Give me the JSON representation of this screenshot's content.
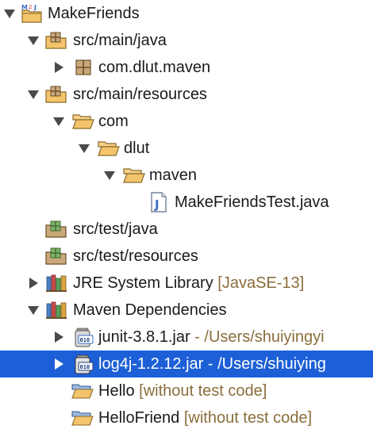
{
  "tree": {
    "project": {
      "label": "MakeFriends",
      "icon": "maven-project-icon",
      "expanded": true
    },
    "src_main_java": {
      "label": "src/main/java",
      "icon": "source-folder-icon",
      "expanded": true
    },
    "pkg_com_dlut_maven": {
      "label": "com.dlut.maven",
      "icon": "package-icon",
      "expanded": false
    },
    "src_main_resources": {
      "label": "src/main/resources",
      "icon": "source-folder-icon",
      "expanded": true
    },
    "folder_com": {
      "label": "com",
      "icon": "folder-icon",
      "expanded": true
    },
    "folder_dlut": {
      "label": "dlut",
      "icon": "folder-icon",
      "expanded": true
    },
    "folder_maven": {
      "label": "maven",
      "icon": "folder-icon",
      "expanded": true
    },
    "file_test_java": {
      "label": "MakeFriendsTest.java",
      "icon": "java-file-icon"
    },
    "src_test_java": {
      "label": "src/test/java",
      "icon": "source-folder-icon"
    },
    "src_test_resources": {
      "label": "src/test/resources",
      "icon": "source-folder-icon"
    },
    "jre_library": {
      "label": "JRE System Library",
      "decoration": "[JavaSE-13]",
      "icon": "library-icon",
      "expanded": false
    },
    "maven_deps": {
      "label": "Maven Dependencies",
      "icon": "library-icon",
      "expanded": true
    },
    "junit_jar": {
      "label": "junit-3.8.1.jar",
      "decoration": "- /Users/shuiyingyi",
      "icon": "jar-icon",
      "expanded": false
    },
    "log4j_jar": {
      "label": "log4j-1.2.12.jar",
      "decoration": "- /Users/shuiying",
      "icon": "jar-icon",
      "expanded": false,
      "selected": true
    },
    "hello_project": {
      "label": "Hello",
      "decoration": "[without test code]",
      "icon": "project-folder-icon"
    },
    "hellofriend_project": {
      "label": "HelloFriend",
      "decoration": "[without test code]",
      "icon": "project-folder-icon"
    }
  },
  "colors": {
    "selection": "#1d5fd6",
    "decoration": "#8a6d3b",
    "folder": "#e8a33a",
    "source_folder_bg": "#c9a97a"
  }
}
